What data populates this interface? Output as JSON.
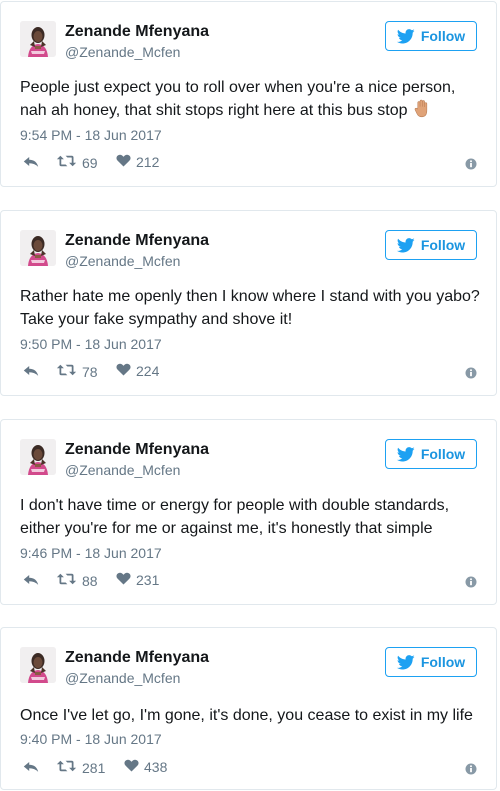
{
  "colors": {
    "brand_blue": "#1da1f2",
    "muted_gray": "#657786",
    "border": "#e1e8ed",
    "hand_emoji": "#e0a378"
  },
  "icons": {
    "follow": "twitter-bird-icon",
    "reply": "reply-icon",
    "retweet": "retweet-icon",
    "like": "heart-icon",
    "info": "info-icon",
    "emoji": "raised-hand-emoji"
  },
  "tweets": [
    {
      "name": "Zenande Mfenyana",
      "handle": "@Zenande_Mcfen",
      "follow_label": "Follow",
      "text": "People just expect you to roll over when you're a nice person, nah ah honey, that shit stops right here at this bus stop",
      "timestamp": "9:54 PM - 18 Jun 2017",
      "retweets": "69",
      "likes": "212"
    },
    {
      "name": "Zenande Mfenyana",
      "handle": "@Zenande_Mcfen",
      "follow_label": "Follow",
      "text": "Rather hate me openly then I know where I stand with you yabo? Take your fake sympathy and shove it!",
      "timestamp": "9:50 PM - 18 Jun 2017",
      "retweets": "78",
      "likes": "224"
    },
    {
      "name": "Zenande Mfenyana",
      "handle": "@Zenande_Mcfen",
      "follow_label": "Follow",
      "text": "I don't have time or energy for people with double standards, either you're for me or against me, it's honestly that simple",
      "timestamp": "9:46 PM - 18 Jun 2017",
      "retweets": "88",
      "likes": "231"
    },
    {
      "name": "Zenande Mfenyana",
      "handle": "@Zenande_Mcfen",
      "follow_label": "Follow",
      "text": "Once I've let go, I'm gone, it's done, you cease to exist in my life",
      "timestamp": "9:40 PM - 18 Jun 2017",
      "retweets": "281",
      "likes": "438"
    }
  ]
}
